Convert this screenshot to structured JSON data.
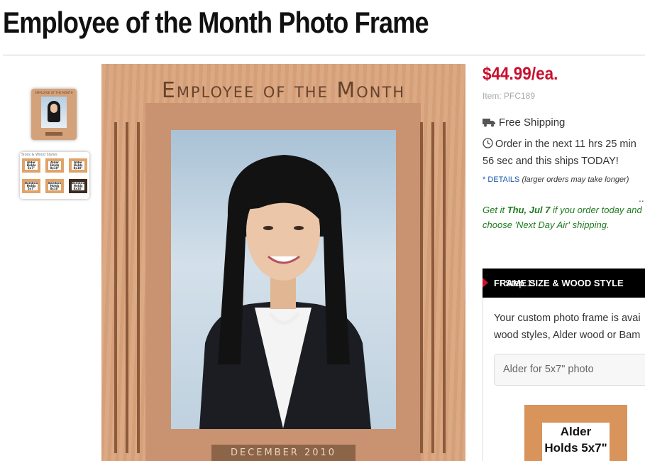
{
  "page_title": "Employee of the Month Photo Frame",
  "thumbnails": {
    "frame_text": "EMPLOYEE OF THE MONTH",
    "sizes_caption": "Sizes & Wood Styles",
    "mini_labels": [
      "Alder Holds 5x7\" photo",
      "Alder Holds 8x10\" photo",
      "Alder Holds 8x10\" photo",
      "Bamboo Holds 5x7\" photo",
      "Bamboo Holds 8x10\" photo",
      "Bamboo Holds 8x10\" photo"
    ]
  },
  "main_image": {
    "frame_text": "Employee of the Month",
    "plaque_text": "DECEMBER 2010"
  },
  "price": "$44.99/ea.",
  "item_number": "Item: PFC189",
  "shipping": {
    "free_shipping": "Free Shipping",
    "order_text": "Order in the next 11 hrs 25 min 56 sec and this ships TODAY!",
    "details_link": "* DETAILS",
    "details_note": "(larger orders may take longer)",
    "get_it_prefix": "Get it ",
    "get_it_date": "Thu, Jul 7",
    "get_it_suffix": " if you order today and choose 'Next Day Air' shipping."
  },
  "step1": {
    "prefix": "Step 1: ",
    "title": "FRAME SIZE & WOOD STYLE",
    "description_line1": "Your custom photo frame is avai",
    "description_line2": "wood styles, Alder wood or Bam",
    "select_value": "Alder for 5x7\" photo",
    "preview_line1": "Alder",
    "preview_line2": "Holds 5x7\""
  },
  "colors": {
    "price": "#c8102e",
    "link": "#1a5ca8",
    "green": "#1f7a1f",
    "step_header_bg": "#000000"
  },
  "icons": [
    "truck-icon",
    "clock-icon"
  ]
}
